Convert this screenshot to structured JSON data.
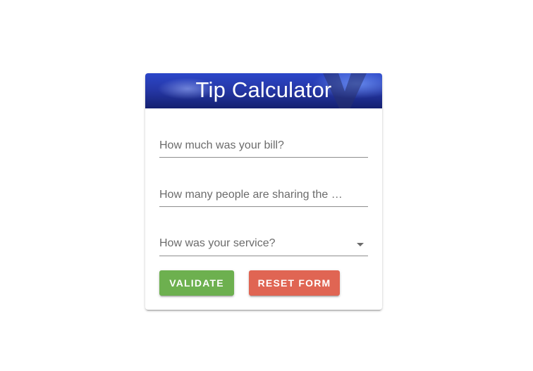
{
  "header": {
    "title": "Tip Calculator"
  },
  "form": {
    "bill_placeholder": "How much was your bill?",
    "people_placeholder": "How many people are sharing the …",
    "service_placeholder": "How was your service?"
  },
  "buttons": {
    "validate_label": "VALIDATE",
    "reset_label": "RESET FORM"
  },
  "colors": {
    "validate": "#6db04f",
    "reset": "#e06553",
    "banner": "#2638a8"
  }
}
